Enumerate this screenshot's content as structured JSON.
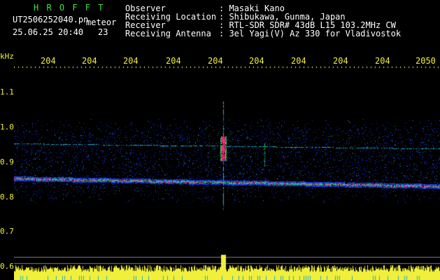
{
  "header": {
    "title": "H R O F F T",
    "filename": "UT2506252040.pn",
    "type_label": "meteor",
    "datetime": "25.06.25 20:40",
    "count": "23",
    "fields": [
      {
        "label": "Observer",
        "value": "Masaki Kano"
      },
      {
        "label": "Receiving Location",
        "value": "Shibukawa, Gunma, Japan"
      },
      {
        "label": "Receiver",
        "value": "RTL-SDR SDR# 43dB L15 103.2MHz CW"
      },
      {
        "label": "Receiving Antenna",
        "value": "3el Yagi(V) Az 330 for Vladivostok"
      }
    ]
  },
  "axis": {
    "unit": "kHz",
    "x_ticks": [
      "204",
      "204",
      "204",
      "204",
      "204",
      "204",
      "204",
      "204",
      "204",
      "2050"
    ],
    "y_ticks": [
      "1.1",
      "1.0",
      "0.9",
      "0.8",
      "0.7",
      "0.6"
    ]
  },
  "colors": {
    "background": "#000000",
    "label_yellow": "#f0f03c",
    "title_green": "#3ce63c",
    "noise_blue": "#1428c8",
    "trace_red": "#e6286e"
  }
}
